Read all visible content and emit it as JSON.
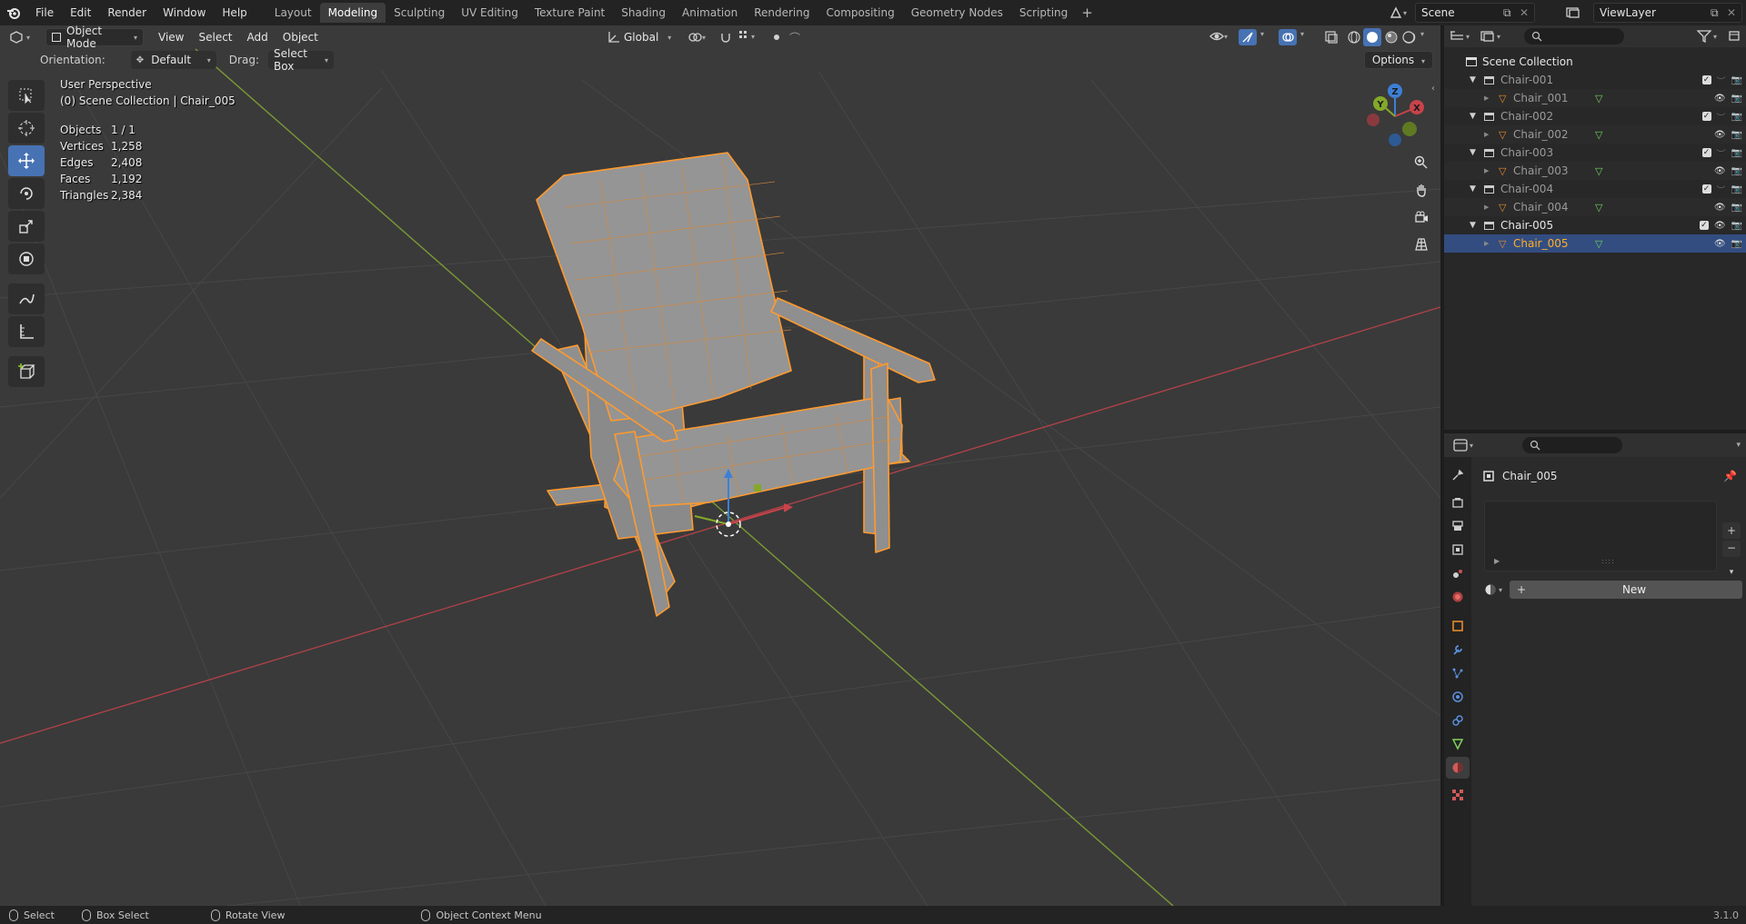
{
  "topbar": {
    "menus": [
      "File",
      "Edit",
      "Render",
      "Window",
      "Help"
    ],
    "workspaces": [
      "Layout",
      "Modeling",
      "Sculpting",
      "UV Editing",
      "Texture Paint",
      "Shading",
      "Animation",
      "Rendering",
      "Compositing",
      "Geometry Nodes",
      "Scripting"
    ],
    "active_workspace": "Modeling",
    "scene": "Scene",
    "view_layer": "ViewLayer"
  },
  "viewport": {
    "mode": "Object Mode",
    "menus": [
      "View",
      "Select",
      "Add",
      "Object"
    ],
    "transform_orientation": "Global",
    "tool_settings": {
      "orientation_label": "Orientation:",
      "orientation_value": "Default",
      "drag_label": "Drag:",
      "drag_value": "Select Box"
    },
    "options_label": "Options",
    "view_name": "User Perspective",
    "collection_info": "(0) Scene Collection | Chair_005",
    "stats": [
      {
        "label": "Objects",
        "value": "1 / 1"
      },
      {
        "label": "Vertices",
        "value": "1,258"
      },
      {
        "label": "Edges",
        "value": "2,408"
      },
      {
        "label": "Faces",
        "value": "1,192"
      },
      {
        "label": "Triangles",
        "value": "2,384"
      }
    ],
    "gizmo_axes": {
      "x": "X",
      "y": "Y",
      "z": "Z"
    }
  },
  "outliner": {
    "root": "Scene Collection",
    "rows": [
      {
        "name": "Chair-001",
        "type": "collection"
      },
      {
        "name": "Chair_001",
        "type": "object"
      },
      {
        "name": "Chair-002",
        "type": "collection"
      },
      {
        "name": "Chair_002",
        "type": "object"
      },
      {
        "name": "Chair-003",
        "type": "collection"
      },
      {
        "name": "Chair_003",
        "type": "object"
      },
      {
        "name": "Chair-004",
        "type": "collection"
      },
      {
        "name": "Chair_004",
        "type": "object"
      },
      {
        "name": "Chair-005",
        "type": "collection"
      },
      {
        "name": "Chair_005",
        "type": "object"
      }
    ],
    "selected": "Chair_005"
  },
  "properties": {
    "object_name": "Chair_005",
    "new_button": "New"
  },
  "statusbar": {
    "items": [
      "Select",
      "Box Select",
      "Rotate View",
      "Object Context Menu"
    ],
    "version": "3.1.0"
  },
  "colors": {
    "accent": "#4772b3",
    "selection_orange": "#ffa033",
    "x_axis": "#c8434a",
    "y_axis": "#84a82a",
    "z_axis": "#3d7fd6"
  }
}
